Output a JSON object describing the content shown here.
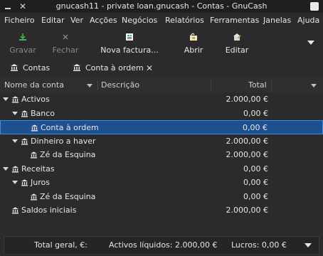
{
  "window": {
    "title": "gnucash11 - private loan.gnucash - Contas - GnuCash"
  },
  "menubar": [
    "Ficheiro",
    "Editar",
    "Ver",
    "Acções",
    "Negócios",
    "Relatórios",
    "Ferramentas",
    "Janelas",
    "Ajuda"
  ],
  "toolbar": {
    "save_label": "Gravar",
    "close_label": "Fechar",
    "new_invoice_label": "Nova factura...",
    "open_label": "Abrir",
    "edit_label": "Editar"
  },
  "tabs": [
    {
      "label": "Contas",
      "icon": "accounts-icon"
    },
    {
      "label": "Conta à ordem",
      "icon": "account-icon"
    }
  ],
  "columns": {
    "name": "Nome da conta",
    "description": "Descrição",
    "total": "Total"
  },
  "accounts": [
    {
      "name": "Activos",
      "total": "2.000,00 €",
      "expanded": true
    },
    {
      "name": "Banco",
      "total": "0,00 €",
      "expanded": true
    },
    {
      "name": "Conta à ordem",
      "total": "0,00 €",
      "selected": true
    },
    {
      "name": "Dinheiro a haver",
      "total": "2.000,00 €",
      "expanded": true
    },
    {
      "name": "Zé da Esquina",
      "total": "2.000,00 €"
    },
    {
      "name": "Receitas",
      "total": "0,00 €",
      "expanded": true
    },
    {
      "name": "Juros",
      "total": "0,00 €",
      "expanded": true
    },
    {
      "name": "Zé da Esquina",
      "total": "0,00 €"
    },
    {
      "name": "Saldos iniciais",
      "total": "2.000,00 €"
    }
  ],
  "summary": {
    "grand_total_label": "Total geral, €:",
    "net_assets": "Activos líquidos: 2.000,00 €",
    "profits": "Lucros: 0,00 €"
  },
  "colors": {
    "background": "#2b2b2b",
    "selection": "#1e4f8f",
    "accent": "#3d8ae0",
    "save_icon": "#4caf50"
  }
}
